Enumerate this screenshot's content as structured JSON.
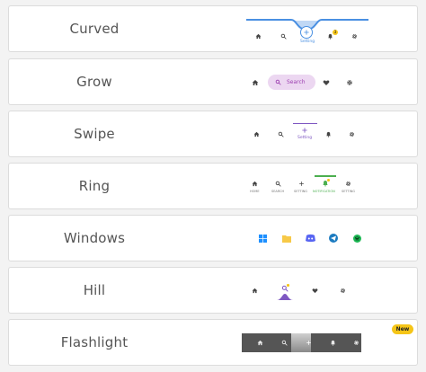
{
  "cards": [
    {
      "title": "Curved"
    },
    {
      "title": "Grow"
    },
    {
      "title": "Swipe"
    },
    {
      "title": "Ring"
    },
    {
      "title": "Windows"
    },
    {
      "title": "Hill"
    },
    {
      "title": "Flashlight"
    }
  ],
  "curved": {
    "active_label": "Setting",
    "notification_badge": "3"
  },
  "grow": {
    "search_label": "Search"
  },
  "swipe": {
    "active_label": "Setting"
  },
  "ring": {
    "labels": [
      "HOME",
      "SEARCH",
      "SETTING",
      "NOTIFICATION",
      "SETTING"
    ],
    "active_index": 3
  },
  "badge": {
    "new_label": "New"
  },
  "colors": {
    "accent_blue": "#4a90e2",
    "grow_purple": "#9c3fb0",
    "grow_pill": "#ecd7f1",
    "ring_green": "#4caf50",
    "hill_purple": "#7e57c2",
    "flashlight_bar": "#555555",
    "new_badge": "#f5c518"
  }
}
